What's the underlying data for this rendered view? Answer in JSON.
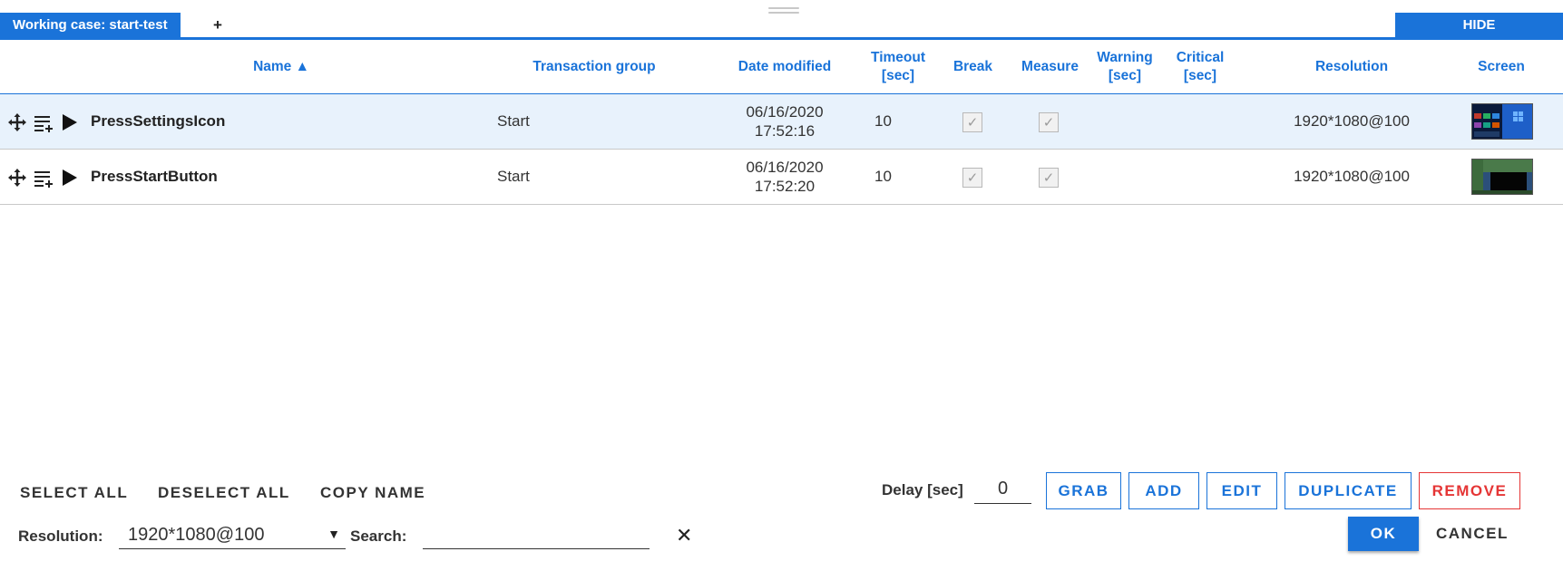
{
  "tabs": {
    "active_label": "Working case: start-test",
    "add_label": "+",
    "hide_label": "HIDE"
  },
  "table": {
    "columns": {
      "name": "Name ▲",
      "transaction_group": "Transaction group",
      "date_modified": "Date modified",
      "timeout": "Timeout\n[sec]",
      "break": "Break",
      "measure": "Measure",
      "warning": "Warning\n[sec]",
      "critical": "Critical\n[sec]",
      "resolution": "Resolution",
      "screen": "Screen"
    },
    "rows": [
      {
        "name": "PressSettingsIcon",
        "transaction_group": "Start",
        "date_modified": "06/16/2020\n17:52:16",
        "timeout": "10",
        "break": true,
        "measure": true,
        "warning": "",
        "critical": "",
        "resolution": "1920*1080@100",
        "selected": true
      },
      {
        "name": "PressStartButton",
        "transaction_group": "Start",
        "date_modified": "06/16/2020\n17:52:20",
        "timeout": "10",
        "break": true,
        "measure": true,
        "warning": "",
        "critical": "",
        "resolution": "1920*1080@100",
        "selected": false
      }
    ],
    "checkmark": "✓"
  },
  "actions": {
    "select_all": "SELECT ALL",
    "deselect_all": "DESELECT ALL",
    "copy_name": "COPY NAME",
    "delay_label": "Delay [sec]",
    "delay_value": "0",
    "grab": "GRAB",
    "add": "ADD",
    "edit": "EDIT",
    "duplicate": "DUPLICATE",
    "remove": "REMOVE",
    "ok": "OK",
    "cancel": "CANCEL"
  },
  "filters": {
    "resolution_label": "Resolution:",
    "resolution_value": "1920*1080@100",
    "search_label": "Search:",
    "search_value": "",
    "clear_icon": "✕"
  },
  "colors": {
    "accent": "#1a73d9",
    "danger": "#e53535",
    "selected_row": "#e8f2fc"
  },
  "icons": [
    "move-icon",
    "details-icon",
    "play-icon",
    "dropdown-arrow-icon",
    "clear-icon"
  ]
}
